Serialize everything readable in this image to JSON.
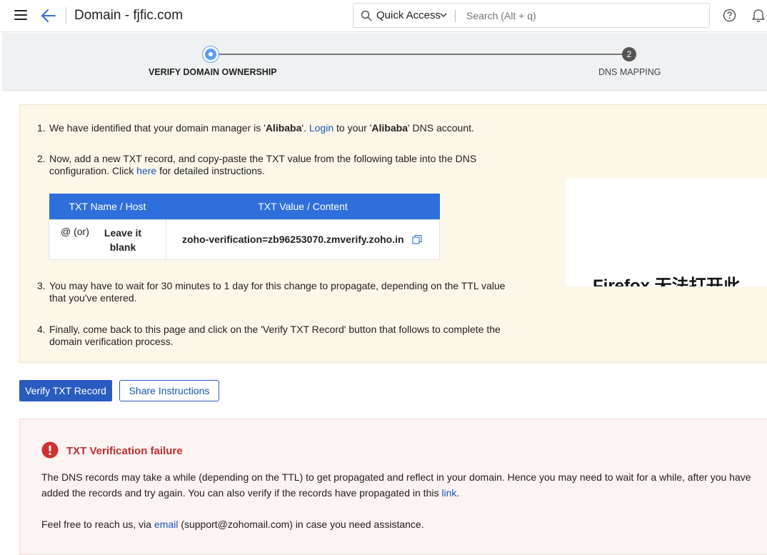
{
  "header": {
    "title": "Domain - fjfic.com",
    "quick_access": "Quick Access",
    "search_placeholder": "Search (Alt + q)"
  },
  "stepper": {
    "steps": [
      {
        "number": "",
        "label": "VERIFY DOMAIN OWNERSHIP",
        "active": true
      },
      {
        "number": "2",
        "label": "DNS MAPPING",
        "active": false
      }
    ]
  },
  "instructions": {
    "step1": {
      "num": "1.",
      "a": "We have identified that your domain manager is '",
      "manager": "Alibaba",
      "b": "'. ",
      "login": "Login",
      "c": " to your '",
      "manager2": "Alibaba",
      "d": "' DNS account."
    },
    "step2": {
      "num": "2.",
      "a": "Now, add a new TXT record, and copy-paste the TXT value from the following table into the DNS configuration. Click ",
      "here": "here",
      "b": " for detailed instructions."
    },
    "table": {
      "headers": [
        "TXT Name / Host",
        "TXT Value / Content"
      ],
      "host_prefix": "@ (or)",
      "host_alt": "Leave it blank",
      "value": "zoho-verification=zb96253070.zmverify.zoho.in"
    },
    "step3": {
      "num": "3.",
      "text": "You may have to wait for 30 minutes to 1 day for this change to propagate, depending on the TTL value that you've entered."
    },
    "step4": {
      "num": "4.",
      "text": "Finally, come back to this page and click on the 'Verify TXT Record' button that follows to complete the domain verification process."
    }
  },
  "overlay_text": "Firefox 无法打开此",
  "buttons": {
    "verify": "Verify TXT Record",
    "share": "Share Instructions"
  },
  "error": {
    "title": "TXT Verification failure",
    "p1a": "The DNS records may take a while (depending on the TTL) to get propagated and reflect in your domain. Hence you may need to wait for a while, after you have added the records and try again. You can also verify if the records have propagated in this ",
    "p1_link": "link",
    "p1b": ".",
    "p2a": "Feel free to reach us, via ",
    "p2_link": "email",
    "p2b": " (support@zohomail.com) in case you need assistance."
  },
  "colors": {
    "primary": "#2a5cbf",
    "error": "#d0312d",
    "instructions_bg": "#fdf7ea",
    "error_bg": "#fcf3f3"
  }
}
